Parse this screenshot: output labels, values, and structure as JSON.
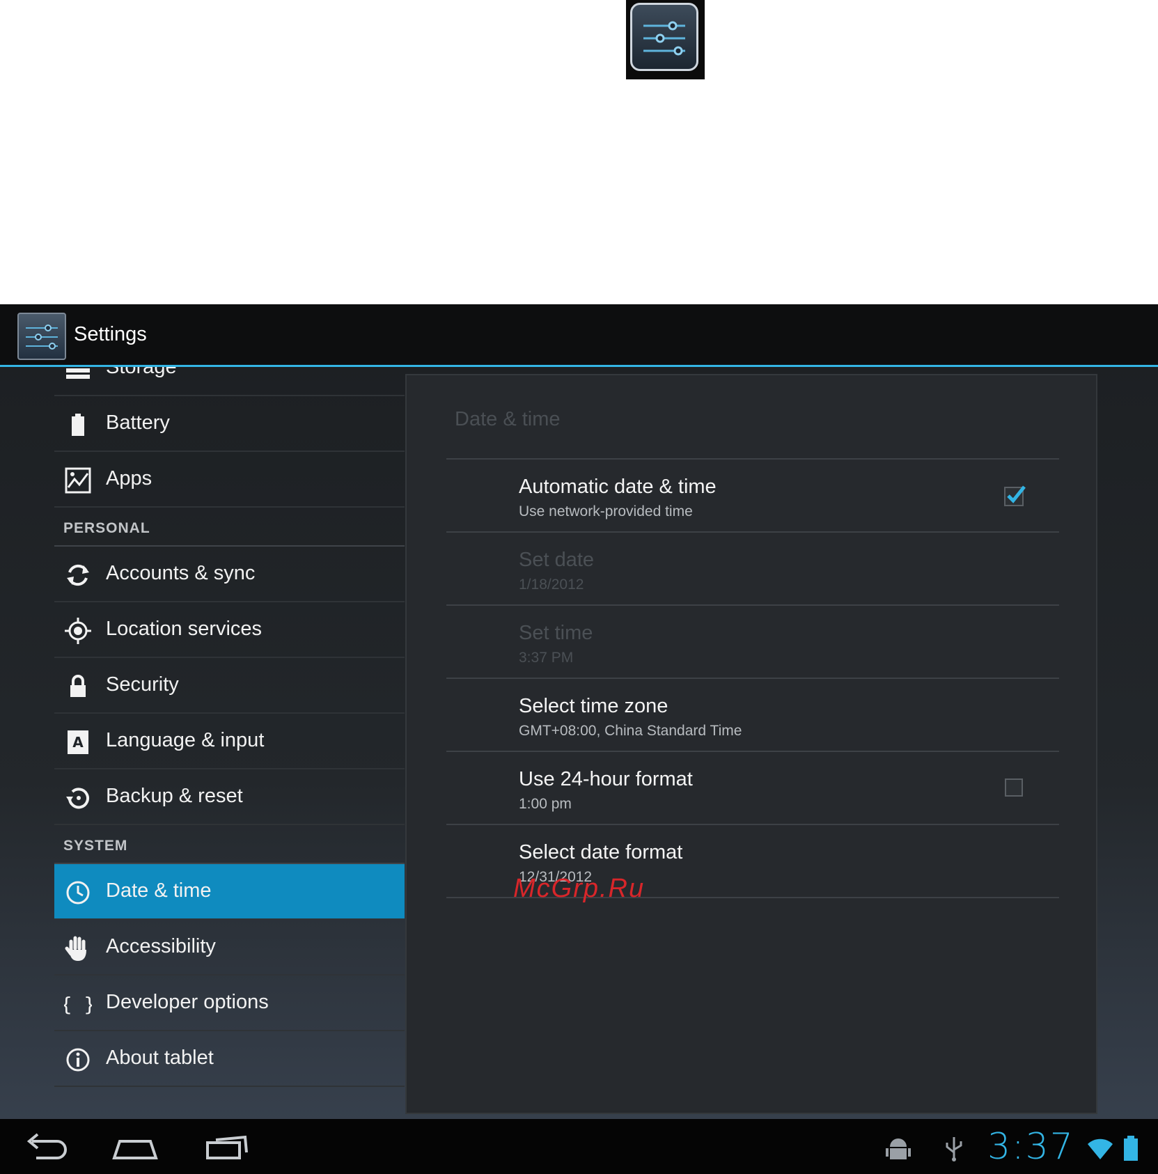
{
  "colors": {
    "accent": "#33b5e5",
    "selected": "#0f8bbf",
    "watermark": "#d8262a"
  },
  "icons": {
    "top": "settings-sliders-icon",
    "storage": "storage-icon",
    "battery": "battery-icon",
    "apps": "apps-icon",
    "accounts": "sync-icon",
    "location": "location-icon",
    "security": "lock-icon",
    "language": "language-icon",
    "backup": "backup-icon",
    "datetime": "clock-icon",
    "accessibility": "hand-icon",
    "developer": "braces-icon",
    "about": "info-icon"
  },
  "action_bar": {
    "title": "Settings"
  },
  "sidebar": {
    "items_top": [
      {
        "label": "Storage"
      },
      {
        "label": "Battery"
      },
      {
        "label": "Apps"
      }
    ],
    "personal_header": "PERSONAL",
    "items_personal": [
      {
        "label": "Accounts & sync"
      },
      {
        "label": "Location services"
      },
      {
        "label": "Security"
      },
      {
        "label": "Language & input"
      },
      {
        "label": "Backup & reset"
      }
    ],
    "system_header": "SYSTEM",
    "items_system": [
      {
        "label": "Date & time",
        "selected": true
      },
      {
        "label": "Accessibility"
      },
      {
        "label": "Developer options"
      },
      {
        "label": "About tablet"
      }
    ]
  },
  "content": {
    "title": "Date & time",
    "prefs": [
      {
        "title": "Automatic date & time",
        "summary": "Use network-provided time",
        "checked": true
      },
      {
        "title": "Set date",
        "summary": "1/18/2012",
        "disabled": true
      },
      {
        "title": "Set time",
        "summary": "3:37 PM",
        "disabled": true
      },
      {
        "title": "Select time zone",
        "summary": "GMT+08:00, China Standard Time"
      },
      {
        "title": "Use 24-hour format",
        "summary": "1:00 pm",
        "checked": false
      },
      {
        "title": "Select date format",
        "summary": "12/31/2012"
      }
    ]
  },
  "watermark": "McGrp.Ru",
  "status_bar": {
    "clock": "3:37"
  }
}
